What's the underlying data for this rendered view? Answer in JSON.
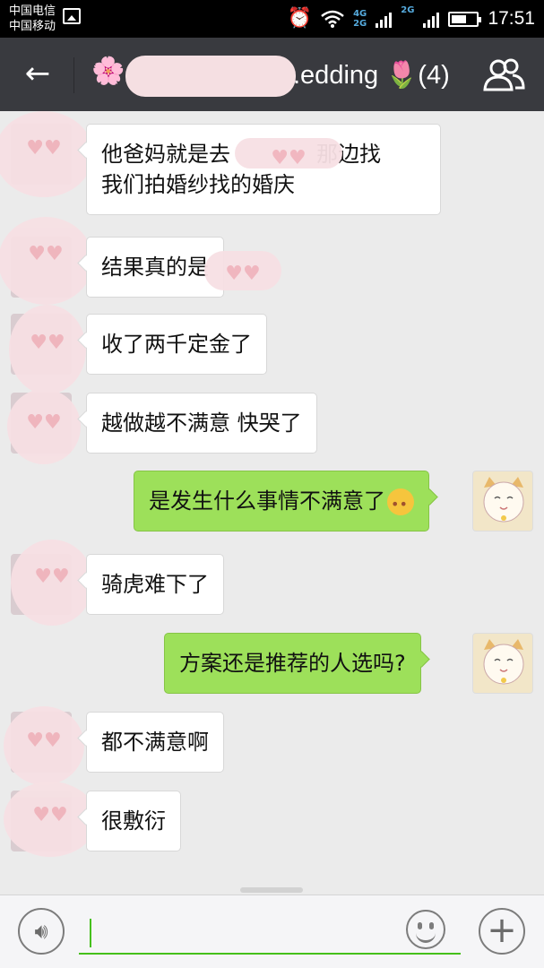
{
  "status_bar": {
    "carrier_1": "中国电信",
    "carrier_2": "中国移动",
    "network_1": "4G",
    "network_2": "2G",
    "network_3": "2G",
    "time": "17:51",
    "icons": [
      "image-icon",
      "alarm-icon",
      "wifi-icon",
      "signal-icon",
      "battery-icon"
    ]
  },
  "header": {
    "back_icon": "arrow-left-icon",
    "title": ".edding 🌷(4)",
    "title_prefix_icon": "🌸",
    "members_icon": "group-icon"
  },
  "messages": [
    {
      "side": "in",
      "text": "他爸妈就是去　　　　那边找\n我们拍婚纱找的婚庆"
    },
    {
      "side": "in",
      "text": "结果真的是"
    },
    {
      "side": "in",
      "text": "收了两千定金了"
    },
    {
      "side": "in",
      "text": "越做越不满意 快哭了"
    },
    {
      "side": "out",
      "text": "是发生什么事情不满意了"
    },
    {
      "side": "in",
      "text": "骑虎难下了"
    },
    {
      "side": "out",
      "text": "方案还是推荐的人选吗?"
    },
    {
      "side": "in",
      "text": "都不满意啊"
    },
    {
      "side": "in",
      "text": "很敷衍"
    }
  ],
  "input_bar": {
    "voice_icon": "voice-icon",
    "text_value": "",
    "emoji_icon": "smiley-icon",
    "more_icon": "plus-icon"
  },
  "colors": {
    "header_bg": "#393a3f",
    "outgoing_bubble": "#9de05a",
    "incoming_bubble": "#ffffff",
    "chat_bg": "#ebebeb",
    "input_accent": "#45c01a"
  }
}
